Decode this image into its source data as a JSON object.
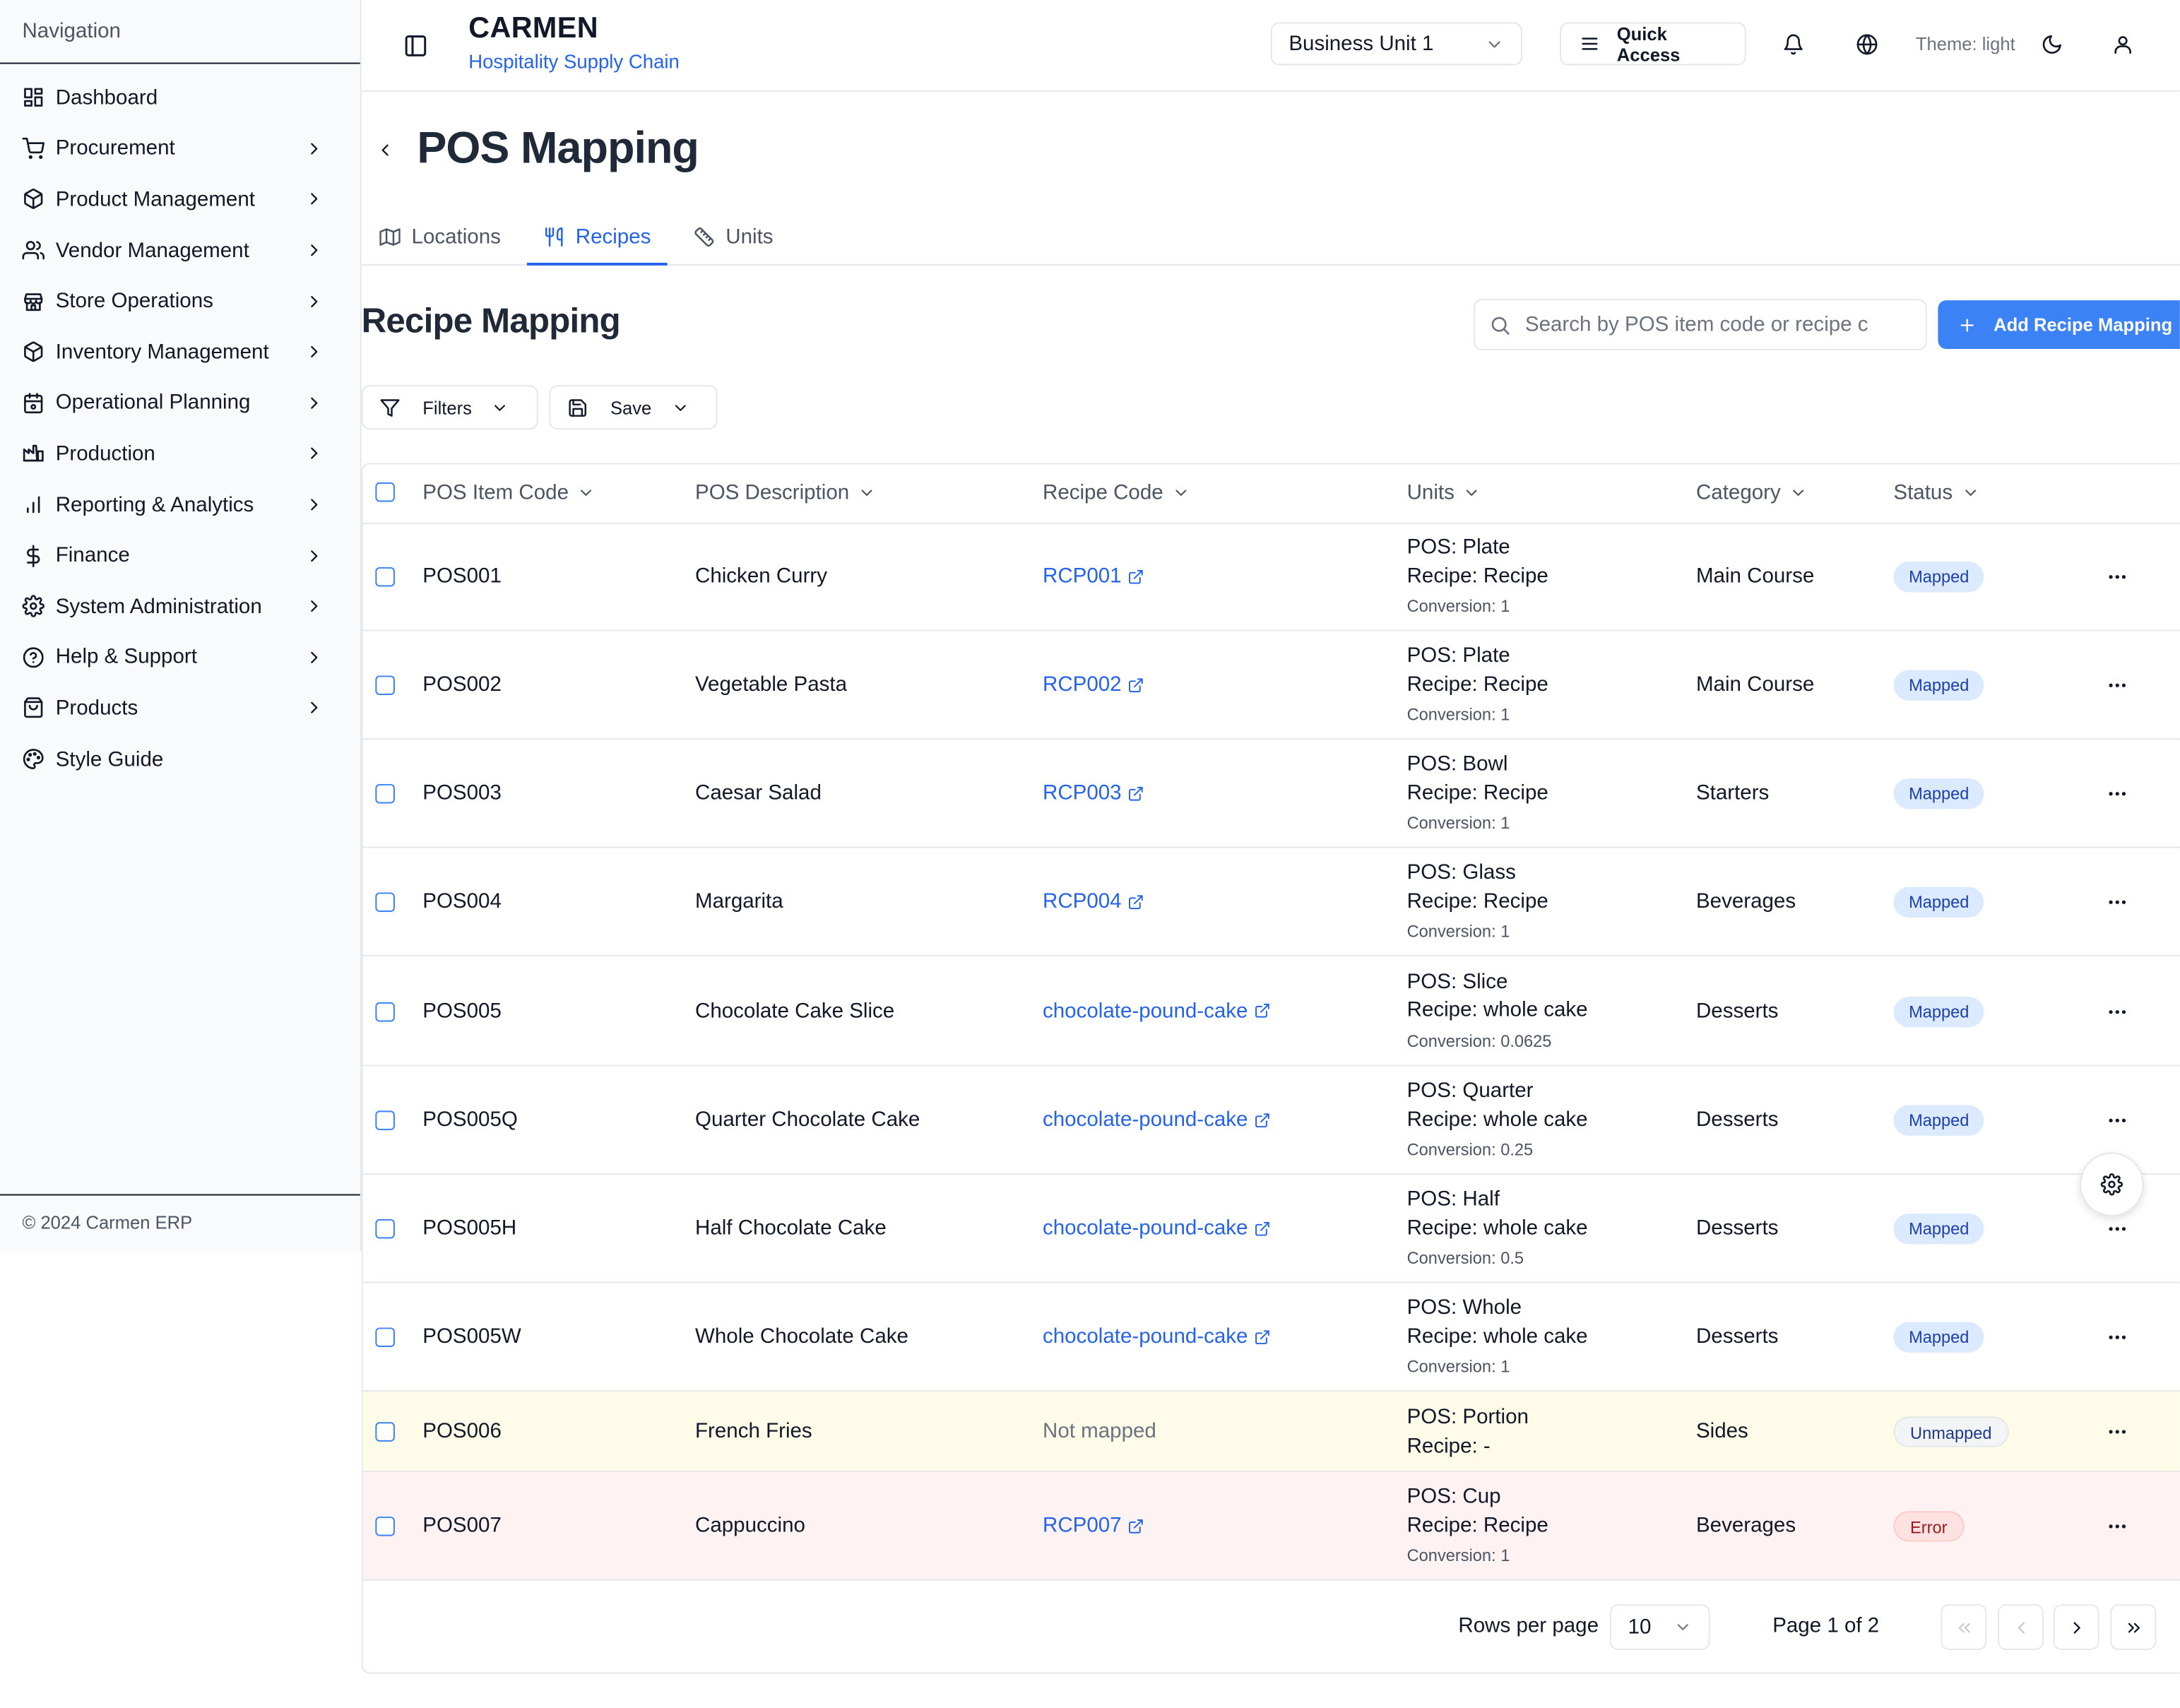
{
  "sidebar": {
    "title": "Navigation",
    "items": [
      {
        "label": "Dashboard",
        "icon": "dashboard-icon",
        "has_children": false
      },
      {
        "label": "Procurement",
        "icon": "cart-icon",
        "has_children": true
      },
      {
        "label": "Product Management",
        "icon": "package-icon",
        "has_children": true
      },
      {
        "label": "Vendor Management",
        "icon": "users-icon",
        "has_children": true
      },
      {
        "label": "Store Operations",
        "icon": "store-icon",
        "has_children": true
      },
      {
        "label": "Inventory Management",
        "icon": "package-icon",
        "has_children": true
      },
      {
        "label": "Operational Planning",
        "icon": "calendar-icon",
        "has_children": true
      },
      {
        "label": "Production",
        "icon": "factory-icon",
        "has_children": true
      },
      {
        "label": "Reporting & Analytics",
        "icon": "bar-chart-icon",
        "has_children": true
      },
      {
        "label": "Finance",
        "icon": "dollar-icon",
        "has_children": true
      },
      {
        "label": "System Administration",
        "icon": "gear-icon",
        "has_children": true
      },
      {
        "label": "Help & Support",
        "icon": "help-icon",
        "has_children": true
      },
      {
        "label": "Products",
        "icon": "shopping-bag-icon",
        "has_children": true
      },
      {
        "label": "Style Guide",
        "icon": "palette-icon",
        "has_children": false
      }
    ],
    "footer": "© 2024 Carmen ERP"
  },
  "header": {
    "brand": "CARMEN",
    "subtitle": "Hospitality Supply Chain",
    "business_unit": "Business Unit 1",
    "quick_access": "Quick Access",
    "theme_label": "Theme: light"
  },
  "page": {
    "title": "POS Mapping",
    "tabs": [
      {
        "label": "Locations",
        "icon": "map-icon",
        "active": false
      },
      {
        "label": "Recipes",
        "icon": "utensils-icon",
        "active": true
      },
      {
        "label": "Units",
        "icon": "ruler-icon",
        "active": false
      }
    ],
    "section_title": "Recipe Mapping",
    "search_placeholder": "Search by POS item code or recipe c",
    "add_button": "Add Recipe Mapping",
    "filters_label": "Filters",
    "save_label": "Save"
  },
  "table": {
    "columns": [
      "POS Item Code",
      "POS Description",
      "Recipe Code",
      "Units",
      "Category",
      "Status"
    ],
    "rows": [
      {
        "code": "POS001",
        "description": "Chicken Curry",
        "recipe": "RCP001",
        "pos_unit_label": "POS:",
        "pos_unit": "Plate",
        "recipe_unit_label": "Recipe:",
        "recipe_unit": "Recipe",
        "conversion": "Conversion: 1",
        "category": "Main Course",
        "status": "Mapped"
      },
      {
        "code": "POS002",
        "description": "Vegetable Pasta",
        "recipe": "RCP002",
        "pos_unit_label": "POS:",
        "pos_unit": "Plate",
        "recipe_unit_label": "Recipe:",
        "recipe_unit": "Recipe",
        "conversion": "Conversion: 1",
        "category": "Main Course",
        "status": "Mapped"
      },
      {
        "code": "POS003",
        "description": "Caesar Salad",
        "recipe": "RCP003",
        "pos_unit_label": "POS:",
        "pos_unit": "Bowl",
        "recipe_unit_label": "Recipe:",
        "recipe_unit": "Recipe",
        "conversion": "Conversion: 1",
        "category": "Starters",
        "status": "Mapped"
      },
      {
        "code": "POS004",
        "description": "Margarita",
        "recipe": "RCP004",
        "pos_unit_label": "POS:",
        "pos_unit": "Glass",
        "recipe_unit_label": "Recipe:",
        "recipe_unit": "Recipe",
        "conversion": "Conversion: 1",
        "category": "Beverages",
        "status": "Mapped"
      },
      {
        "code": "POS005",
        "description": "Chocolate Cake Slice",
        "recipe": "chocolate-pound-cake",
        "pos_unit_label": "POS:",
        "pos_unit": "Slice",
        "recipe_unit_label": "Recipe:",
        "recipe_unit": "whole cake",
        "conversion": "Conversion: 0.0625",
        "category": "Desserts",
        "status": "Mapped"
      },
      {
        "code": "POS005Q",
        "description": "Quarter Chocolate Cake",
        "recipe": "chocolate-pound-cake",
        "pos_unit_label": "POS:",
        "pos_unit": "Quarter",
        "recipe_unit_label": "Recipe:",
        "recipe_unit": "whole cake",
        "conversion": "Conversion: 0.25",
        "category": "Desserts",
        "status": "Mapped"
      },
      {
        "code": "POS005H",
        "description": "Half Chocolate Cake",
        "recipe": "chocolate-pound-cake",
        "pos_unit_label": "POS:",
        "pos_unit": "Half",
        "recipe_unit_label": "Recipe:",
        "recipe_unit": "whole cake",
        "conversion": "Conversion: 0.5",
        "category": "Desserts",
        "status": "Mapped"
      },
      {
        "code": "POS005W",
        "description": "Whole Chocolate Cake",
        "recipe": "chocolate-pound-cake",
        "pos_unit_label": "POS:",
        "pos_unit": "Whole",
        "recipe_unit_label": "Recipe:",
        "recipe_unit": "whole cake",
        "conversion": "Conversion: 1",
        "category": "Desserts",
        "status": "Mapped"
      },
      {
        "code": "POS006",
        "description": "French Fries",
        "recipe": "Not mapped",
        "pos_unit_label": "POS:",
        "pos_unit": "Portion",
        "recipe_unit_label": "Recipe:",
        "recipe_unit": "-",
        "conversion": "",
        "category": "Sides",
        "status": "Unmapped"
      },
      {
        "code": "POS007",
        "description": "Cappuccino",
        "recipe": "RCP007",
        "pos_unit_label": "POS:",
        "pos_unit": "Cup",
        "recipe_unit_label": "Recipe:",
        "recipe_unit": "Recipe",
        "conversion": "Conversion: 1",
        "category": "Beverages",
        "status": "Error"
      }
    ]
  },
  "pagination": {
    "rows_per_page_label": "Rows per page",
    "rows_per_page": "10",
    "page_info": "Page 1 of 2"
  },
  "colors": {
    "accent": "#3b82f6",
    "link": "#2563eb",
    "mapped_badge": "#dbeafe",
    "unmapped_row": "#fefce8",
    "error_row": "#fef2f2"
  }
}
